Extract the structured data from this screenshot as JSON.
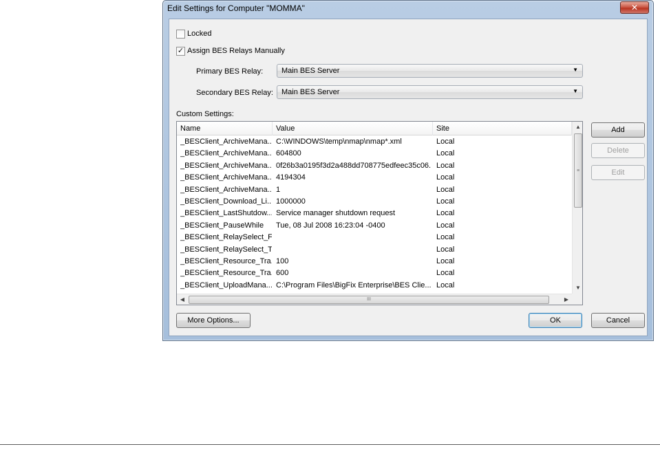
{
  "dialog": {
    "title": "Edit Settings for Computer \"MOMMA\"",
    "close_glyph": "✕"
  },
  "locked": {
    "label": "Locked",
    "checked": false
  },
  "assign_relays": {
    "label": "Assign BES Relays Manually",
    "checked": true,
    "check_glyph": "✓"
  },
  "primary_relay": {
    "label": "Primary BES Relay:",
    "value": "Main BES Server"
  },
  "secondary_relay": {
    "label": "Secondary BES Relay:",
    "value": "Main BES Server"
  },
  "custom_settings": {
    "label": "Custom Settings:",
    "columns": [
      "Name",
      "Value",
      "Site"
    ],
    "sort_glyph": "^",
    "rows": [
      [
        "_BESClient_ArchiveMana...",
        "C:\\WINDOWS\\temp\\nmap\\nmap*.xml",
        "Local"
      ],
      [
        "_BESClient_ArchiveMana...",
        "604800",
        "Local"
      ],
      [
        "_BESClient_ArchiveMana...",
        "0f26b3a0195f3d2a488dd708775edfeec35c06...",
        "Local"
      ],
      [
        "_BESClient_ArchiveMana...",
        "4194304",
        "Local"
      ],
      [
        "_BESClient_ArchiveMana...",
        "1",
        "Local"
      ],
      [
        "_BESClient_Download_Li...",
        "1000000",
        "Local"
      ],
      [
        "_BESClient_LastShutdow...",
        "Service manager shutdown request",
        "Local"
      ],
      [
        "_BESClient_PauseWhile",
        "Tue, 08 Jul 2008 16:23:04 -0400",
        "Local"
      ],
      [
        "_BESClient_RelaySelect_F...",
        "",
        "Local"
      ],
      [
        "_BESClient_RelaySelect_T...",
        "",
        "Local"
      ],
      [
        "_BESClient_Resource_Tra...",
        "100",
        "Local"
      ],
      [
        "_BESClient_Resource_Tra...",
        "600",
        "Local"
      ],
      [
        "_BESClient_UploadMana...",
        "C:\\Program Files\\BigFix Enterprise\\BES Clie...",
        "Local"
      ]
    ],
    "scroll_grip": "≡",
    "hscroll_grip": "III"
  },
  "buttons": {
    "add": "Add",
    "delete": "Delete",
    "edit": "Edit",
    "more_options": "More Options...",
    "ok": "OK",
    "cancel": "Cancel"
  },
  "glyphs": {
    "dropdown": "▼",
    "up": "▲",
    "down": "▼",
    "left": "◀",
    "right": "▶"
  }
}
